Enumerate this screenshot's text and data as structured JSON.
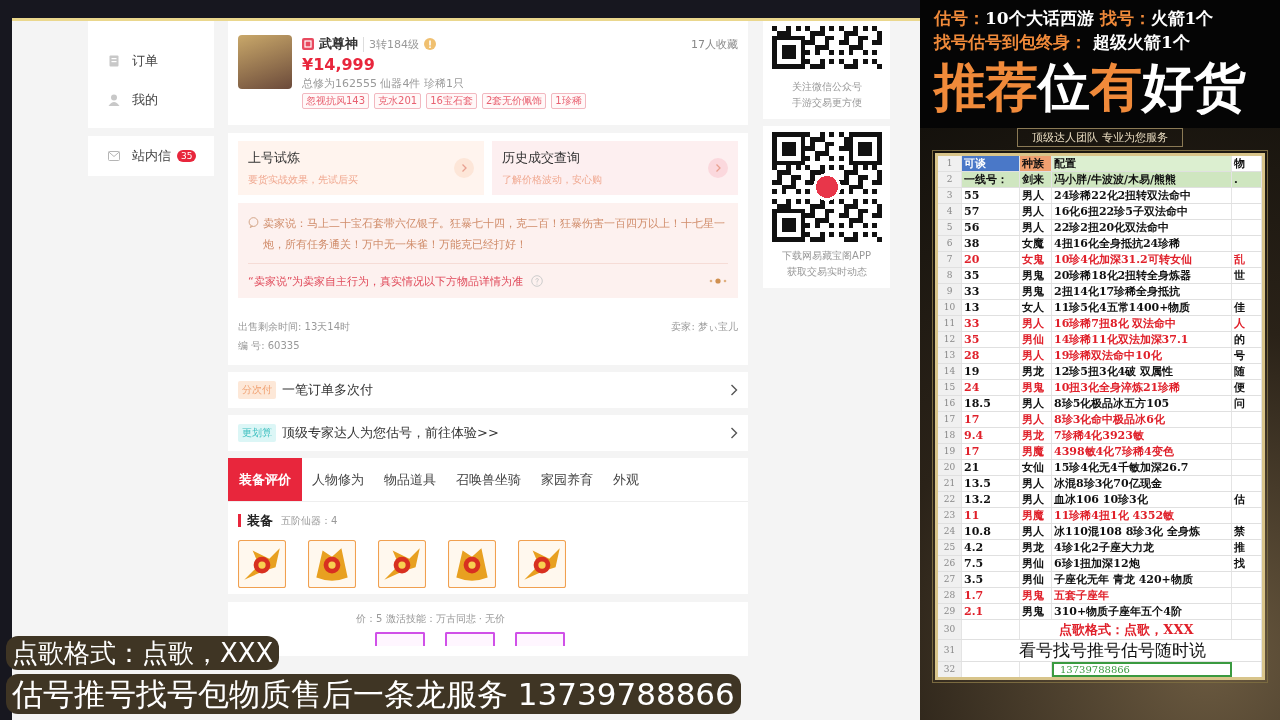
{
  "sidebar": {
    "items": [
      {
        "label": "订单",
        "kind": "order"
      },
      {
        "label": "我的",
        "kind": "profile"
      }
    ],
    "messages": {
      "label": "站内信",
      "badge": "35"
    }
  },
  "product": {
    "name": "武尊神",
    "level": "3转184级",
    "favorites": "17人收藏",
    "price": "¥14,999",
    "stats": "总修为162555  仙器4件  珍稀1只",
    "tags": [
      "忽视抗风143",
      "克水201",
      "16宝石套",
      "2套无价佩饰",
      "1珍稀"
    ]
  },
  "trial_cards": [
    {
      "title": "上号试炼",
      "subtitle": "要货实战效果，先试后买",
      "kind": "trial"
    },
    {
      "title": "历史成交查询",
      "subtitle": "了解价格波动，安心购",
      "kind": "history"
    }
  ],
  "seller_note": {
    "text": "卖家说：马上二十宝石套带六亿银子。狂暴七十四，克二百！狂暴伤害一百四万以上！十七星一炮，所有任务通关！万中无一朱雀！万能克已经打好！",
    "disclaimer": "“卖家说”为卖家自主行为，真实情况以下方物品详情为准"
  },
  "listing": {
    "time_left": "出售剩余时间: 13天14时",
    "seller": "卖家: 梦ぃ宝儿",
    "serial": "编 号: 60335"
  },
  "promos": [
    {
      "tag": "分次付",
      "text": "一笔订单多次付",
      "kind": "installment"
    },
    {
      "tag": "更划算",
      "text": "顶级专家达人为您估号，前往体验>>",
      "kind": "appraisal"
    }
  ],
  "tabs": [
    {
      "label": "装备评价",
      "selected": true
    },
    {
      "label": "人物修为",
      "selected": false
    },
    {
      "label": "物品道具",
      "selected": false
    },
    {
      "label": "召唤兽坐骑",
      "selected": false
    },
    {
      "label": "家园养育",
      "selected": false
    },
    {
      "label": "外观",
      "selected": false
    }
  ],
  "equipment": {
    "title": "装备",
    "subtitle": "五阶仙器：4"
  },
  "equipment_2": {
    "text": "价：5   激活技能：万古同悲 · 无价"
  },
  "qr_panels": [
    {
      "lines": [
        "关注微信公众号",
        "手游交易更方便"
      ],
      "kind": "wechat"
    },
    {
      "lines": [
        "下载网易藏宝阁APP",
        "获取交易实时动态"
      ],
      "kind": "app"
    }
  ],
  "promo_banner": {
    "lines": [
      [
        {
          "text": "估号：",
          "kind": "accent"
        },
        {
          "text": "10个大话西游",
          "kind": "plain"
        },
        {
          "text": " 找号：",
          "kind": "accent"
        },
        {
          "text": "火箭1个",
          "kind": "plain"
        }
      ],
      [
        {
          "text": "找号估号到包终身：",
          "kind": "accent"
        },
        {
          "text": " 超级火箭1个",
          "kind": "plain"
        }
      ]
    ],
    "headline": [
      {
        "text": "推荐",
        "kind": "accent"
      },
      {
        "text": "位",
        "kind": "plain"
      },
      {
        "text": "有",
        "kind": "accent"
      },
      {
        "text": "好货",
        "kind": "plain"
      }
    ],
    "tagline": "顶级达人团队  专业为您服务"
  },
  "sheet": {
    "header": {
      "num": "1",
      "cells": [
        "可谈",
        "种族",
        "配置",
        "物"
      ]
    },
    "rows": [
      {
        "num": "2",
        "kind": "group",
        "value": "一线号：",
        "race": "剑来",
        "config": "冯小胖/牛波波/木易/熊熊",
        "note": "."
      },
      {
        "num": "3",
        "kind": "data",
        "value": "55",
        "race": "男人",
        "config": "24珍稀22化2扭转双法命中",
        "value_hot": false,
        "config_hot": false
      },
      {
        "num": "4",
        "kind": "data",
        "value": "57",
        "race": "男人",
        "config": "16化6扭22珍5子双法命中",
        "value_hot": false,
        "config_hot": false
      },
      {
        "num": "5",
        "kind": "data",
        "value": "56",
        "race": "男人",
        "config": "22珍2扭20化双法命中",
        "value_hot": false,
        "config_hot": false
      },
      {
        "num": "6",
        "kind": "data",
        "value": "38",
        "race": "女魔",
        "config": "4扭16化全身抵抗24珍稀",
        "value_hot": false,
        "config_hot": false
      },
      {
        "num": "7",
        "kind": "data",
        "value": "20",
        "race": "女鬼",
        "config": "10珍4化加深31.2可转女仙",
        "note": "乱",
        "value_hot": true,
        "config_hot": true,
        "note_hot": true
      },
      {
        "num": "8",
        "kind": "data",
        "value": "35",
        "race": "男鬼",
        "config": "20珍稀18化2扭转全身炼器",
        "note": "世",
        "value_hot": false,
        "config_hot": false,
        "note_hot": false
      },
      {
        "num": "9",
        "kind": "data",
        "value": "33",
        "race": "男鬼",
        "config": "2扭14化17珍稀全身抵抗",
        "value_hot": false,
        "config_hot": false
      },
      {
        "num": "10",
        "kind": "data",
        "value": "13",
        "race": "女人",
        "config": "11珍5化4五常1400+物质",
        "note": "佳",
        "value_hot": false,
        "config_hot": false,
        "note_hot": false
      },
      {
        "num": "11",
        "kind": "data",
        "value": "33",
        "race": "男人",
        "config": "16珍稀7扭8化 双法命中",
        "note": "人",
        "value_hot": true,
        "config_hot": true,
        "note_hot": true
      },
      {
        "num": "12",
        "kind": "data",
        "value": "35",
        "race": "男仙",
        "config": "14珍稀11化双法加深37.1",
        "note": "的",
        "value_hot": true,
        "config_hot": true,
        "note_hot": false
      },
      {
        "num": "13",
        "kind": "data",
        "value": "28",
        "race": "男人",
        "config": "19珍稀双法命中10化",
        "note": "号",
        "value_hot": true,
        "config_hot": true,
        "note_hot": false
      },
      {
        "num": "14",
        "kind": "data",
        "value": "19",
        "race": "男龙",
        "config": "12珍5扭3化4破  双属性",
        "note": "随",
        "value_hot": false,
        "config_hot": false,
        "note_hot": false
      },
      {
        "num": "15",
        "kind": "data",
        "value": "24",
        "race": "男鬼",
        "config": "10扭3化全身淬炼21珍稀",
        "note": "便",
        "value_hot": true,
        "config_hot": true,
        "note_hot": false
      },
      {
        "num": "16",
        "kind": "data",
        "value": "18.5",
        "race": "男人",
        "config": "8珍5化极品冰五方105",
        "note": "问",
        "value_hot": false,
        "config_hot": false,
        "note_hot": false
      },
      {
        "num": "17",
        "kind": "data",
        "value": "17",
        "race": "男人",
        "config": "8珍3化命中极品冰6化",
        "value_hot": true,
        "config_hot": true
      },
      {
        "num": "18",
        "kind": "data",
        "value": "9.4",
        "race": "男龙",
        "config": "7珍稀4化3923敏",
        "value_hot": true,
        "config_hot": true
      },
      {
        "num": "19",
        "kind": "data",
        "value": "17",
        "race": "男魔",
        "config": "4398敏4化7珍稀4变色",
        "value_hot": true,
        "config_hot": true
      },
      {
        "num": "20",
        "kind": "data",
        "value": "21",
        "race": "女仙",
        "config": "15珍4化无4千敏加深26.7",
        "value_hot": false,
        "config_hot": false
      },
      {
        "num": "21",
        "kind": "data",
        "value": "13.5",
        "race": "男人",
        "config": "冰混8珍3化70亿现金",
        "value_hot": false,
        "config_hot": false
      },
      {
        "num": "22",
        "kind": "data",
        "value": "13.2",
        "race": "男人",
        "config": "血冰106  10珍3化",
        "note": "估",
        "value_hot": false,
        "config_hot": false,
        "note_hot": false
      },
      {
        "num": "23",
        "kind": "data",
        "value": "11",
        "race": "男魔",
        "config": "11珍稀4扭1化  4352敏",
        "value_hot": true,
        "config_hot": true
      },
      {
        "num": "24",
        "kind": "data",
        "value": "10.8",
        "race": "男人",
        "config": "冰110混108  8珍3化  全身炼",
        "note": "禁",
        "value_hot": false,
        "config_hot": false,
        "note_hot": false
      },
      {
        "num": "25",
        "kind": "data",
        "value": "4.2",
        "race": "男龙",
        "config": "4珍1化2子座大力龙",
        "note": "推",
        "value_hot": false,
        "config_hot": false,
        "note_hot": false
      },
      {
        "num": "26",
        "kind": "data",
        "value": "7.5",
        "race": "男仙",
        "config": "6珍1扭加深12炮",
        "note": "找",
        "value_hot": false,
        "config_hot": false,
        "note_hot": false
      },
      {
        "num": "27",
        "kind": "data",
        "value": "3.5",
        "race": "男仙",
        "config": "子座化无年  青龙 420+物质",
        "value_hot": false,
        "config_hot": false
      },
      {
        "num": "28",
        "kind": "data",
        "value": "1.7",
        "race": "男鬼",
        "config": "五套子座年",
        "value_hot": true,
        "config_hot": true
      },
      {
        "num": "29",
        "kind": "data",
        "value": "2.1",
        "race": "男鬼",
        "config": "310+物质子座年五个4阶",
        "value_hot": true,
        "config_hot": false
      },
      {
        "num": "30",
        "kind": "note",
        "config": "点歌格式：点歌，XXX"
      },
      {
        "num": "31",
        "kind": "banner",
        "config": "看号找号推号估号随时说"
      },
      {
        "num": "32",
        "kind": "phone",
        "config": "13739788866"
      }
    ]
  },
  "overlay": {
    "lines": [
      "点歌格式：点歌，XXX",
      "估号推号找号包物质售后一条龙服务 13739788866"
    ]
  }
}
